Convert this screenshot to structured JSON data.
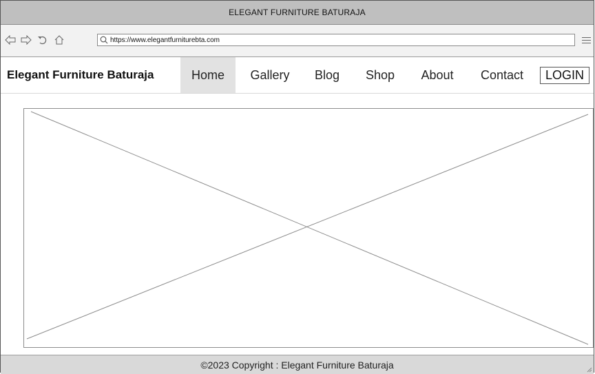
{
  "window": {
    "title": "ELEGANT FURNITURE BATURAJA"
  },
  "toolbar": {
    "url": "https://www.elegantfurniturebta.com",
    "icons": [
      "back-icon",
      "forward-icon",
      "reload-icon",
      "home-icon",
      "search-icon",
      "menu-icon"
    ]
  },
  "navbar": {
    "brand": "Elegant Furniture Baturaja",
    "items": [
      {
        "label": "Home",
        "active": true
      },
      {
        "label": "Gallery",
        "active": false
      },
      {
        "label": "Blog",
        "active": false
      },
      {
        "label": "Shop",
        "active": false
      },
      {
        "label": "About",
        "active": false
      },
      {
        "label": "Contact",
        "active": false
      }
    ],
    "login_label": "LOGIN"
  },
  "footer": {
    "text": "©2023 Copyright : Elegant Furniture Baturaja"
  }
}
